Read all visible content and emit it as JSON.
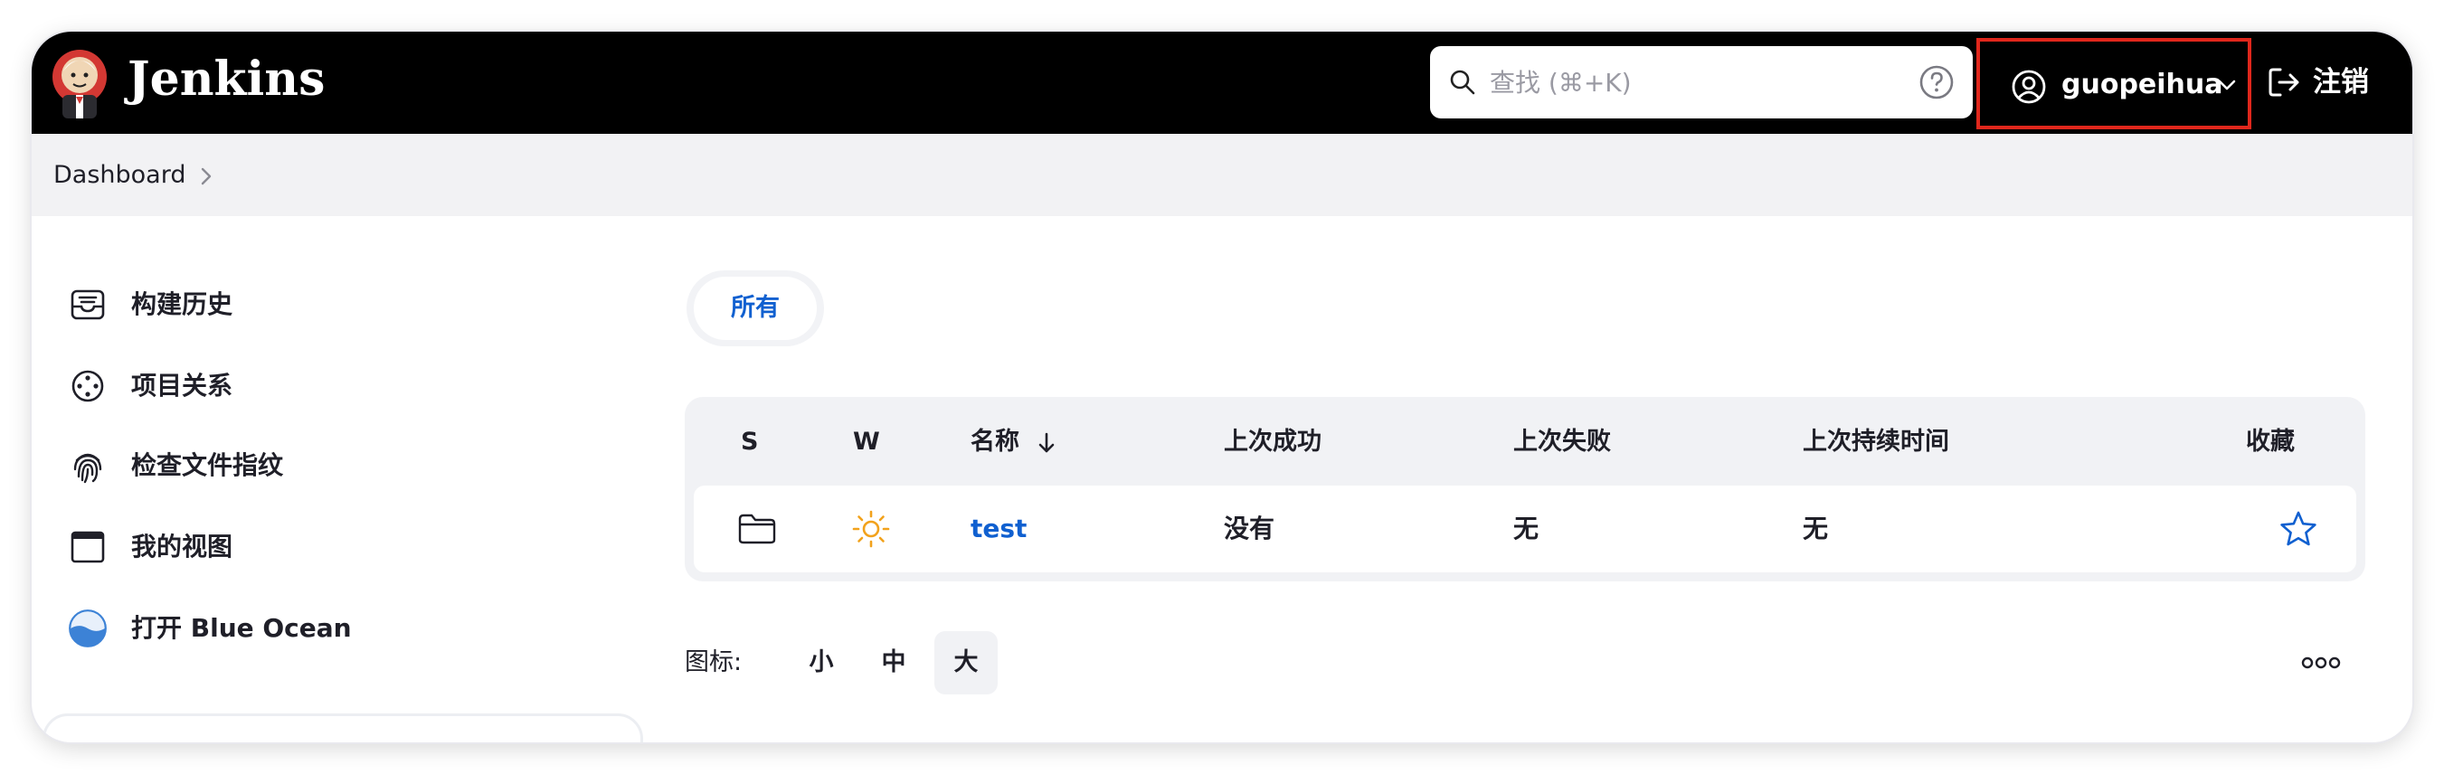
{
  "header": {
    "brand": "Jenkins",
    "search_placeholder": "查找 (⌘+K)",
    "username": "guopeihua",
    "logout_label": "注销"
  },
  "breadcrumb": {
    "items": [
      "Dashboard"
    ]
  },
  "sidebar": {
    "items": [
      {
        "label": "构建历史",
        "icon": "build-history-icon"
      },
      {
        "label": "项目关系",
        "icon": "project-relationship-icon"
      },
      {
        "label": "检查文件指纹",
        "icon": "fingerprint-icon"
      },
      {
        "label": "我的视图",
        "icon": "my-views-icon"
      },
      {
        "label": "打开 Blue Ocean",
        "icon": "blue-ocean-icon"
      }
    ]
  },
  "views": {
    "tabs": [
      "所有"
    ],
    "active": "所有"
  },
  "table": {
    "headers": {
      "status": "S",
      "weather": "W",
      "name": "名称",
      "last_success": "上次成功",
      "last_failure": "上次失败",
      "last_duration": "上次持续时间",
      "favorite": "收藏"
    },
    "sort": "name-descending",
    "rows": [
      {
        "status_icon": "folder-icon",
        "weather_icon": "sun-icon",
        "name": "test",
        "last_success": "没有",
        "last_failure": "无",
        "last_duration": "无",
        "favorite_icon": "star-outline-icon"
      }
    ]
  },
  "icon_size": {
    "label": "图标:",
    "options": [
      "小",
      "中",
      "大"
    ],
    "selected": "大"
  },
  "colors": {
    "header_bg": "#000000",
    "accent": "#1060d0",
    "highlight_border": "#e0271c",
    "sun": "#f2a21c"
  }
}
